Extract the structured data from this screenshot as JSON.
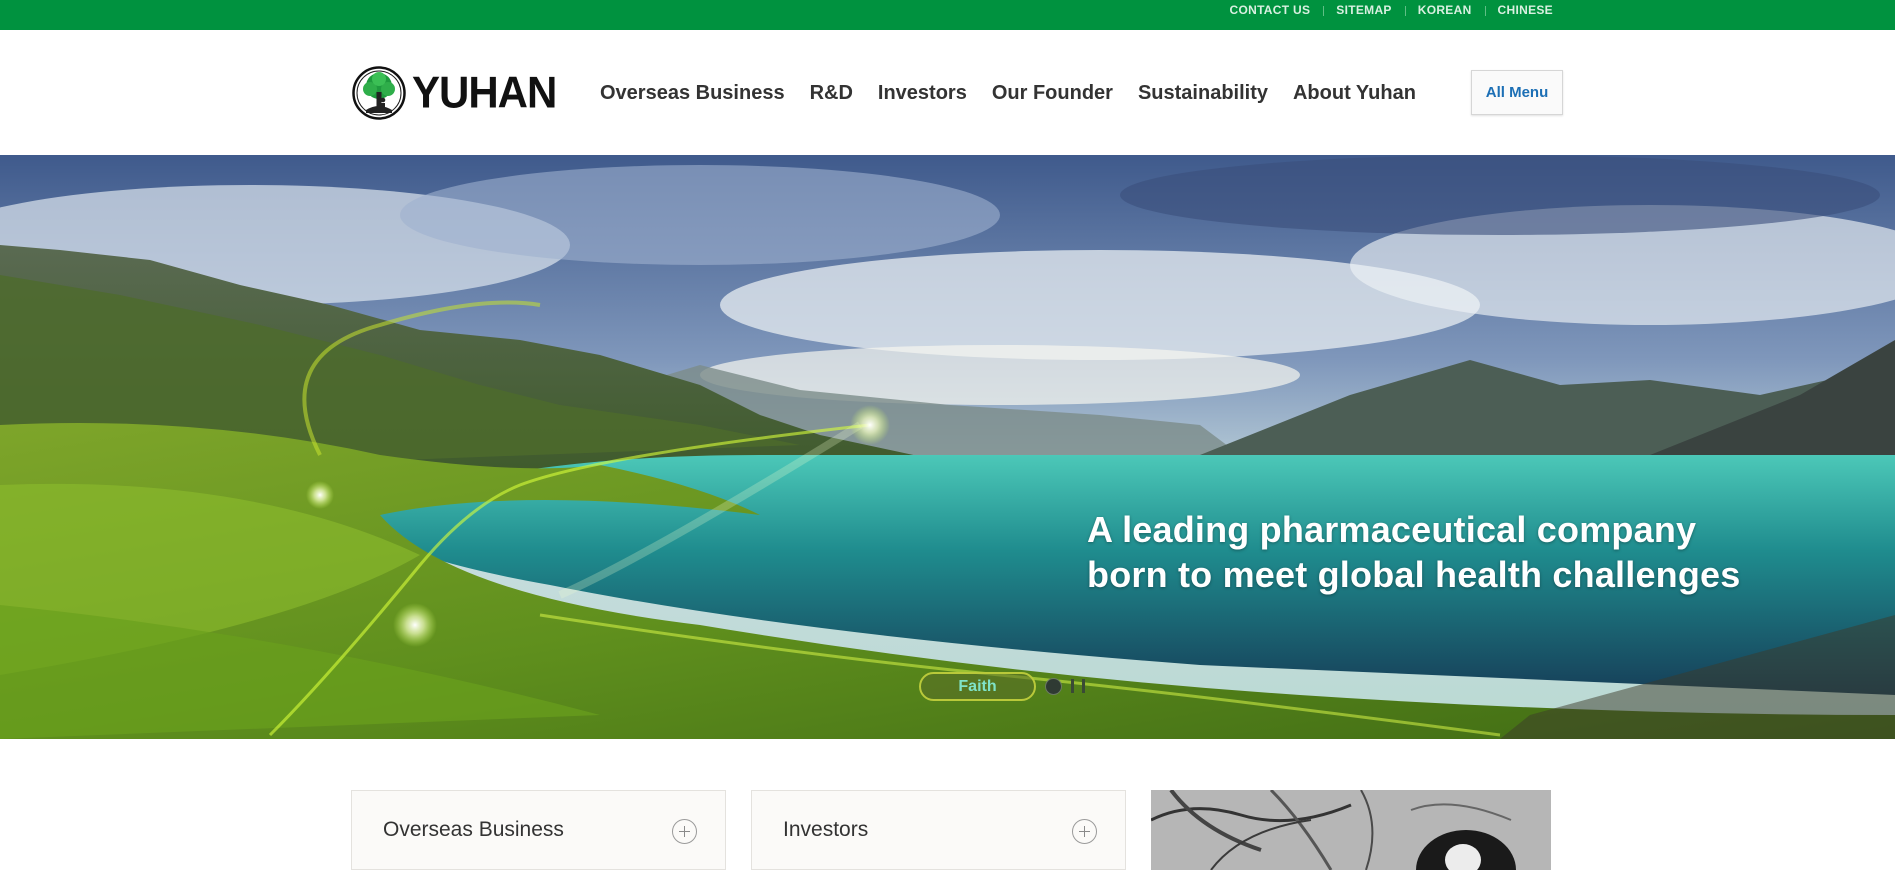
{
  "utility_nav": [
    "CONTACT US",
    "SITEMAP",
    "KOREAN",
    "CHINESE"
  ],
  "logo": {
    "text": "YUHAN"
  },
  "main_nav": [
    "Overseas Business",
    "R&D",
    "Investors",
    "Our Founder",
    "Sustainability",
    "About Yuhan"
  ],
  "all_menu_label": "All Menu",
  "hero": {
    "headline_line1": "A leading pharmaceutical company",
    "headline_line2": "born to meet global health challenges",
    "slide_label": "Faith"
  },
  "cards": [
    {
      "title": "Overseas Business"
    },
    {
      "title": "Investors"
    }
  ],
  "colors": {
    "brand_green": "#00923f",
    "link_blue": "#1c6fb5"
  }
}
